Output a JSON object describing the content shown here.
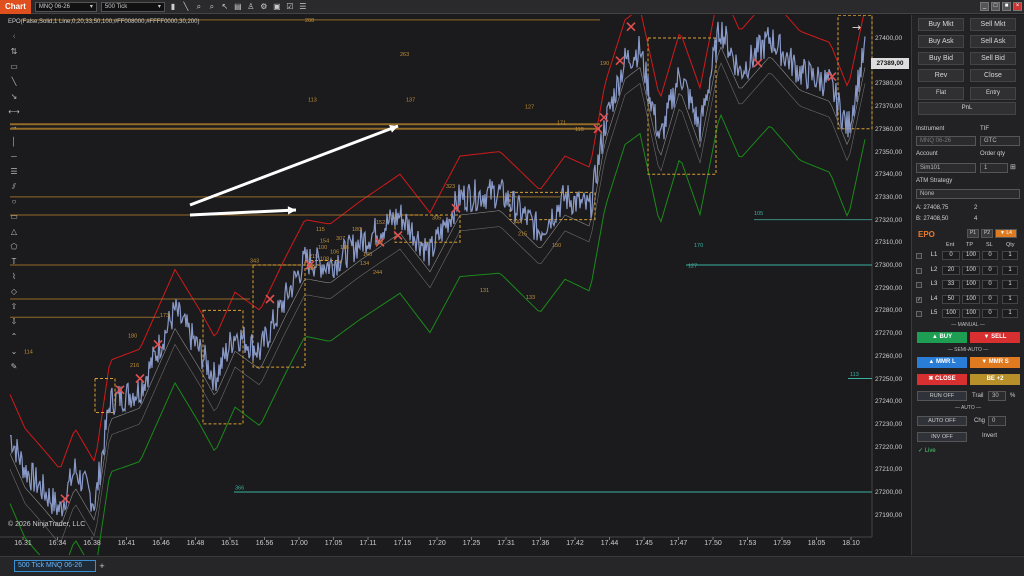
{
  "toolbar": {
    "tab_label": "Chart",
    "instrument": "MNQ 06-26",
    "period": "500 Tick"
  },
  "indicator_label": "EPO(False,Solid,1 Line,0,20,33,50,100,#FF008000,#FFFF0000,30,200)",
  "copyright": "© 2026 NinjaTrader, LLC",
  "price_axis": {
    "labels": [
      "27400,00",
      "27390,00",
      "27380,00",
      "27370,00",
      "27360,00",
      "27350,00",
      "27340,00",
      "27330,00",
      "27320,00",
      "27310,00",
      "27300,00",
      "27290,00",
      "27280,00",
      "27270,00",
      "27260,00",
      "27250,00",
      "27240,00",
      "27230,00",
      "27220,00",
      "27210,00",
      "27200,00",
      "27190,00"
    ],
    "current_price": "27389,00"
  },
  "time_axis": {
    "labels": [
      "16.31",
      "16.34",
      "16.38",
      "16.41",
      "16.46",
      "16.48",
      "16.51",
      "16.56",
      "17.00",
      "17.05",
      "17.11",
      "17.15",
      "17.20",
      "17.25",
      "17.31",
      "17.36",
      "17.42",
      "17.44",
      "17.45",
      "17.47",
      "17.50",
      "17.53",
      "17.59",
      "18.05",
      "18.10"
    ]
  },
  "chart_annotations": [
    "208",
    "263",
    "113",
    "137",
    "127",
    "171",
    "115",
    "323",
    "305",
    "115",
    "307",
    "142",
    "140",
    "100",
    "108",
    "244",
    "173",
    "114",
    "180",
    "216",
    "343",
    "215",
    "150",
    "133",
    "131",
    "190",
    "105",
    "170",
    "127",
    "366",
    "113",
    "244",
    "215",
    "110",
    "134",
    "152",
    "180",
    "116",
    "154",
    "106"
  ],
  "bottom_tab": "500 Tick MNQ 06-26",
  "panel": {
    "buttons": {
      "buy_mkt": "Buy Mkt",
      "sell_mkt": "Sell Mkt",
      "buy_ask": "Buy Ask",
      "sell_ask": "Sell Ask",
      "buy_bid": "Buy Bid",
      "sell_bid": "Sell Bid",
      "rev": "Rev",
      "close": "Close",
      "flat": "Flat",
      "entry": "Entry",
      "pnl": "PnL"
    },
    "instrument_label": "Instrument",
    "instrument_value": "MNQ 06-26",
    "tif_label": "TIF",
    "tif_value": "GTC",
    "account_label": "Account",
    "account_value": "Sim101",
    "order_qty_label": "Order qty",
    "order_qty_value": "1",
    "atm_label": "ATM Strategy",
    "atm_value": "None",
    "ask_label": "A: 27408,75",
    "ask_size": "2",
    "bid_label": "B: 27408,50",
    "bid_size": "4",
    "epo_title": "EPO",
    "epo_buttons": [
      "P1",
      "P2",
      "▼ L4"
    ],
    "table_headers": [
      "Ent",
      "TP",
      "SL",
      "Qty"
    ],
    "rows": [
      {
        "name": "L1",
        "ent": "0",
        "tp": "100",
        "sl": "0",
        "qty": "1",
        "checked": ""
      },
      {
        "name": "L2",
        "ent": "20",
        "tp": "100",
        "sl": "0",
        "qty": "1",
        "checked": ""
      },
      {
        "name": "L3",
        "ent": "33",
        "tp": "100",
        "sl": "0",
        "qty": "1",
        "checked": ""
      },
      {
        "name": "L4",
        "ent": "50",
        "tp": "100",
        "sl": "0",
        "qty": "1",
        "checked": "✓"
      },
      {
        "name": "L5",
        "ent": "100",
        "tp": "100",
        "sl": "0",
        "qty": "1",
        "checked": ""
      }
    ],
    "manual_sep": "— MANUAL —",
    "buy_label": "▲ BUY",
    "sell_label": "▼ SELL",
    "semi_auto_sep": "— SEMI-AUTO —",
    "mmr_l": "▲ MMR L",
    "mmr_s": "▼ MMR S",
    "close_label": "✖ CLOSE",
    "be_label": "BE +2",
    "run_off": "RUN OFF",
    "trail_label": "Trail",
    "trail_value": "30",
    "pct": "%",
    "auto_sep": "— AUTO —",
    "auto_off": "AUTO OFF",
    "chg_label": "Chg",
    "chg_value": "0",
    "inv_off": "INV OFF",
    "invert_label": "Invert",
    "live_label": "✓ Live"
  },
  "colors": {
    "accent": "#e0501f",
    "buy": "#1e9e52",
    "sell": "#d83030",
    "mmr_l": "#2a7dd6",
    "mmr_s": "#e07a20",
    "be": "#b8902a",
    "upper_band": "#d01a1a",
    "lower_band": "#1a8a1a"
  }
}
